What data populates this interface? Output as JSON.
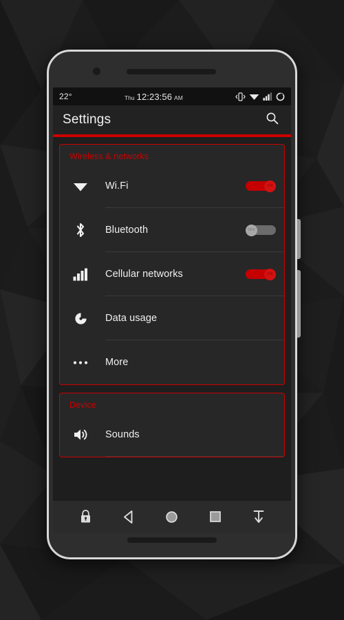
{
  "status_bar": {
    "temperature": "22°",
    "day": "Thu",
    "time": "12:23:56",
    "ampm": "AM",
    "icons": [
      "vibrate-icon",
      "wifi-icon",
      "cellular-signal-icon",
      "battery-icon"
    ]
  },
  "action_bar": {
    "title": "Settings",
    "search_icon": "search-icon",
    "accent_color": "#cc0000"
  },
  "sections": [
    {
      "header": "Wireless & networks",
      "rows": [
        {
          "icon": "wifi-icon",
          "label": "Wi.Fi",
          "toggle": "on",
          "toggle_label": "ON"
        },
        {
          "icon": "bluetooth-icon",
          "label": "Bluetooth",
          "toggle": "off",
          "toggle_label": "OFF"
        },
        {
          "icon": "cellular-signal-icon",
          "label": "Cellular networks",
          "toggle": "on",
          "toggle_label": "ON"
        },
        {
          "icon": "data-usage-icon",
          "label": "Data usage",
          "toggle": "none"
        },
        {
          "icon": "more-icon",
          "label": "More",
          "toggle": "none"
        }
      ]
    },
    {
      "header": "Device",
      "rows": [
        {
          "icon": "sounds-icon",
          "label": "Sounds",
          "toggle": "none"
        }
      ]
    }
  ],
  "nav_bar": {
    "buttons": [
      "lock-icon",
      "back-icon",
      "home-icon",
      "recents-icon",
      "hide-navbar-icon"
    ]
  },
  "colors": {
    "accent_red": "#cc0000",
    "toggle_on": "#c40000",
    "toggle_off": "#6b6b6b",
    "screen_bg": "#1e1e1e",
    "card_bg": "#272727",
    "status_bar_bg": "#111111"
  }
}
